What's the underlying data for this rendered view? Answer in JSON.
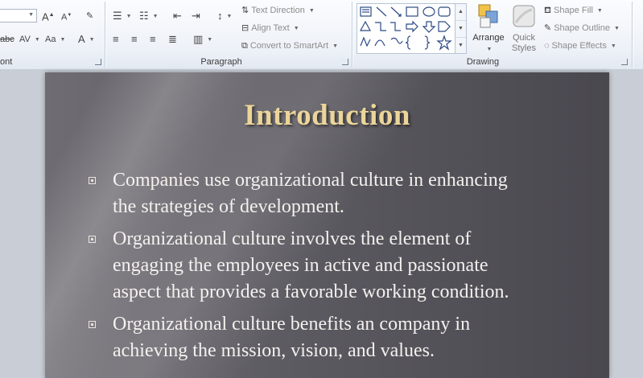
{
  "ribbon": {
    "groups": {
      "font_label": "ont",
      "paragraph_label": "Paragraph",
      "drawing_label": "Drawing"
    },
    "paragraph": {
      "text_direction": "Text Direction",
      "align_text": "Align Text",
      "convert_smartart": "Convert to SmartArt"
    },
    "drawing": {
      "arrange": "Arrange",
      "quick_styles_line1": "Quick",
      "quick_styles_line2": "Styles",
      "shape_fill": "Shape Fill",
      "shape_outline": "Shape Outline",
      "shape_effects": "Shape Effects"
    },
    "font": {
      "strike_label": "abc",
      "spacing_label": "AV",
      "case_label": "Aa",
      "color_label": "A"
    }
  },
  "slide": {
    "title": "Introduction",
    "bullets": [
      {
        "line1": "Companies use organizational culture in enhancing",
        "line2": "the strategies of development.",
        "line3": ""
      },
      {
        "line1": "Organizational culture involves the element of",
        "line2": "engaging the employees in active and passionate",
        "line3": "aspect that provides a favorable working condition."
      },
      {
        "line1": "Organizational culture benefits an company in",
        "line2": "achieving the mission, vision, and values.",
        "line3": ""
      }
    ]
  }
}
